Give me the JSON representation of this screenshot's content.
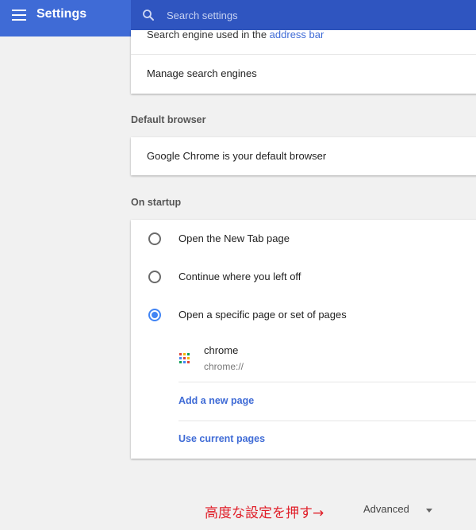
{
  "header": {
    "title": "Settings",
    "search_placeholder": "Search settings"
  },
  "search_engine_card": {
    "partial_row_prefix": "Search engine used in the ",
    "partial_row_link": "address bar",
    "manage_label": "Manage search engines"
  },
  "default_browser": {
    "section_title": "Default browser",
    "status_text": "Google Chrome is your default browser"
  },
  "on_startup": {
    "section_title": "On startup",
    "options": [
      {
        "label": "Open the New Tab page",
        "checked": false
      },
      {
        "label": "Continue where you left off",
        "checked": false
      },
      {
        "label": "Open a specific page or set of pages",
        "checked": true
      }
    ],
    "startup_page": {
      "title": "chrome",
      "url": "chrome://"
    },
    "add_new_page_label": "Add a new page",
    "use_current_pages_label": "Use current pages"
  },
  "footer": {
    "annotation": "高度な設定を押す→",
    "advanced_label": "Advanced"
  },
  "colors": {
    "header_blue": "#3f6bd6",
    "search_blue": "#2f55c0",
    "radio_accent": "#4285f4",
    "annotation_red": "#e0202a"
  },
  "icons": {
    "menu": "hamburger-menu-icon",
    "search": "search-icon",
    "caret": "caret-down-icon",
    "favicon": "app-grid-icon"
  }
}
